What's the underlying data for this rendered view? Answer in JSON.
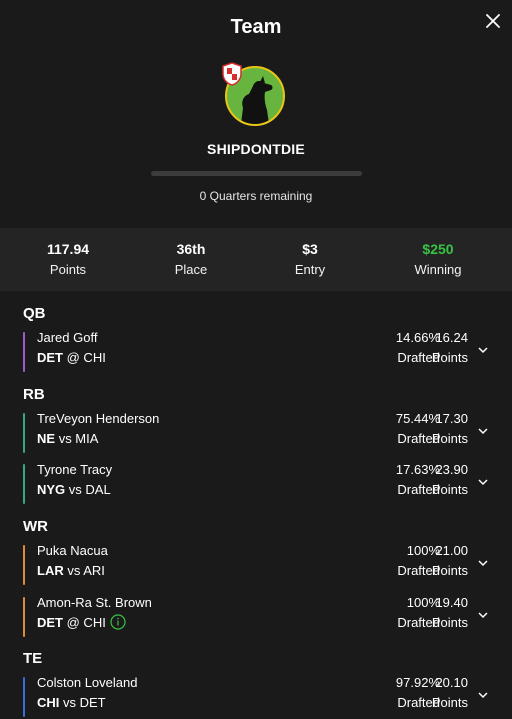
{
  "header": {
    "title": "Team",
    "team_name": "SHIPDONTDIE",
    "remaining": "0 Quarters remaining",
    "progress": 0
  },
  "colors": {
    "qb": "#9d5bd2",
    "rb": "#3aa888",
    "wr": "#e08a3c",
    "te": "#3b6fd6",
    "winning": "#39c345"
  },
  "stats": [
    {
      "value": "117.94",
      "label": "Points"
    },
    {
      "value": "36th",
      "label": "Place"
    },
    {
      "value": "$3",
      "label": "Entry"
    },
    {
      "value": "$250",
      "label": "Winning"
    }
  ],
  "sections": {
    "qb": "QB",
    "rb": "RB",
    "wr": "WR",
    "te": "TE"
  },
  "players": [
    {
      "name": "Jared Goff",
      "team": "DET",
      "matchup": "@ CHI",
      "drafted": "14.66%",
      "drafted_label": "Drafted",
      "points": "16.24",
      "points_label": "Points"
    },
    {
      "name": "TreVeyon Henderson",
      "team": "NE",
      "matchup": "vs MIA",
      "drafted": "75.44%",
      "drafted_label": "Drafted",
      "points": "17.30",
      "points_label": "Points"
    },
    {
      "name": "Tyrone Tracy",
      "team": "NYG",
      "matchup": "vs DAL",
      "drafted": "17.63%",
      "drafted_label": "Drafted",
      "points": "23.90",
      "points_label": "Points"
    },
    {
      "name": "Puka Nacua",
      "team": "LAR",
      "matchup": "vs ARI",
      "drafted": "100%",
      "drafted_label": "Drafted",
      "points": "21.00",
      "points_label": "Points"
    },
    {
      "name": "Amon-Ra St. Brown",
      "team": "DET",
      "matchup": "@ CHI",
      "drafted": "100%",
      "drafted_label": "Drafted",
      "points": "19.40",
      "points_label": "Points"
    },
    {
      "name": "Colston Loveland",
      "team": "CHI",
      "matchup": "vs DET",
      "drafted": "97.92%",
      "drafted_label": "Drafted",
      "points": "20.10",
      "points_label": "Points"
    }
  ]
}
